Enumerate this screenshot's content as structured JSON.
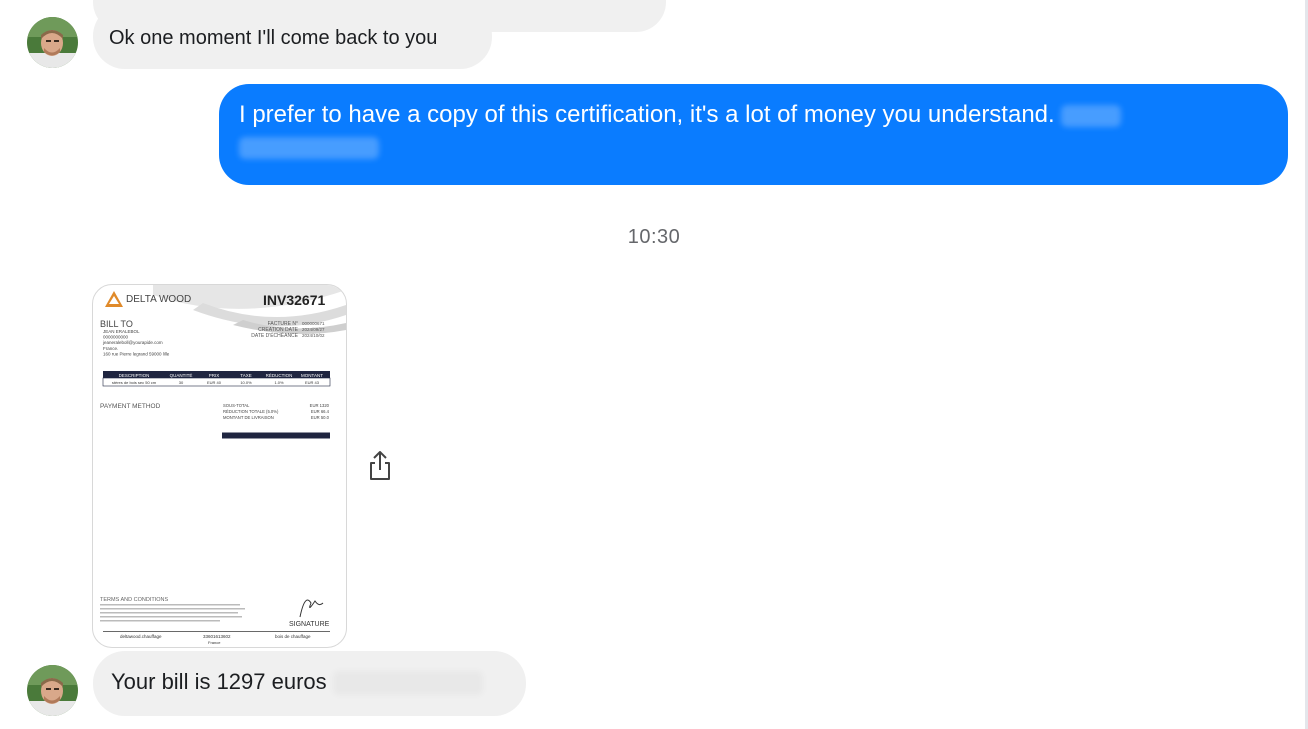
{
  "messages": {
    "m1_text": "Ok one moment I'll come back to you",
    "m2_text": "I prefer to have a copy of this certification, it's a lot of money you understand.",
    "timestamp": "10:30",
    "m3_text": "Your bill is 1297 euros"
  },
  "invoice": {
    "company": "DELTA WOOD",
    "number": "INV32671",
    "bill_to_label": "BILL TO",
    "bill_to_lines": [
      "JEAN ERALEBOL",
      "0000000000",
      "jeaneraleboll@yourapide.com",
      "France.",
      "160 rue Pierre legrand 59000 lille"
    ],
    "meta_labels": [
      "FACTURE N°",
      "CREATION DATE",
      "DATE D'ÉCHÉANCE"
    ],
    "meta_values": [
      "000000671",
      "2024/09/27",
      "2024/10/02"
    ],
    "table_headers": [
      "DESCRIPTION",
      "QUANTITÉ",
      "PRIX",
      "TAXE",
      "RÉDUCTION",
      "MONTANT"
    ],
    "table_row": [
      "stères de bois sec 50 cm",
      "30",
      "EUR 40",
      "10.0%",
      "1.0%",
      "EUR 43"
    ],
    "payment_method_label": "PAYMENT METHOD",
    "totals_labels": [
      "SOUS-TOTAL",
      "RÉDUCTION TOTALE (5.0%)",
      "MONTANT DE LIVRAISON",
      "MONTANT TOTAL"
    ],
    "totals_values": [
      "EUR 1320",
      "EUR 66.4",
      "EUR 50.0",
      "EUR 1297"
    ],
    "terms_label": "TERMS AND CONDITIONS",
    "signature_label": "SIGNATURE",
    "footer": [
      "deltawood.chauffage",
      "33601613602",
      "bois de chauffage"
    ],
    "footer_sub": "France"
  },
  "colors": {
    "outgoing_bubble": "#0a7cff",
    "incoming_bubble": "#f0f0f0",
    "timestamp": "#65676b"
  },
  "icons": {
    "share": "share-icon",
    "logo": "delta-logo-icon"
  }
}
